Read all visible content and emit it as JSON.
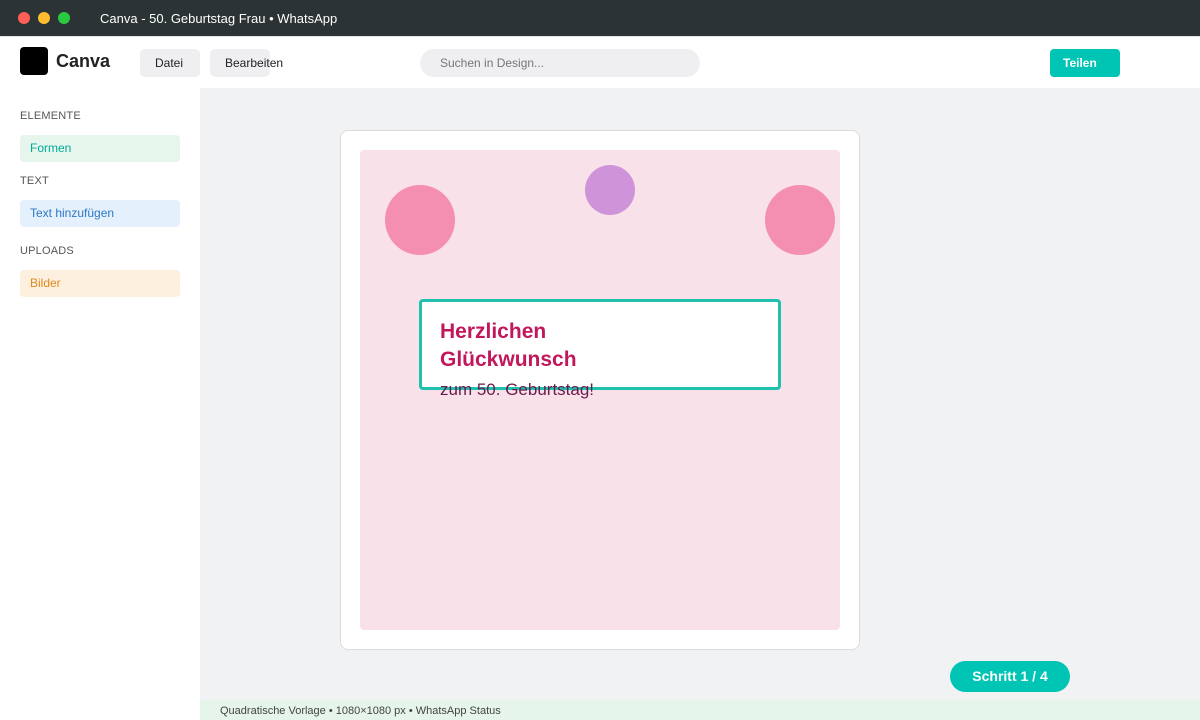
{
  "window": {
    "title": "Canva - 50. Geburtstag Frau • WhatsApp"
  },
  "header": {
    "brand": "Canva",
    "menu": [
      "Datei",
      "Bearbeiten"
    ],
    "search_placeholder": "Suchen in Design...",
    "share_label": "Teilen"
  },
  "sidebar": {
    "sections": [
      {
        "title": "ELEMENTE",
        "item": "Formen"
      },
      {
        "title": "TEXT",
        "item": "Text hinzufügen"
      },
      {
        "title": "UPLOADS",
        "item": "Bilder"
      }
    ]
  },
  "design": {
    "headline": "Herzlichen Glückwunsch",
    "subline": "zum 50. Geburtstag!"
  },
  "step_indicator": "Schritt 1 / 4",
  "status_bar": "Quadratische Vorlage • 1080×1080 px • WhatsApp Status",
  "colors": {
    "accent": "#00c4b4",
    "titlebar": "#2c3335",
    "design_background": "#f9e1e9",
    "headline": "#c2185b",
    "circle_pink": "#f48fb1",
    "circle_purple": "#ce93d8"
  }
}
